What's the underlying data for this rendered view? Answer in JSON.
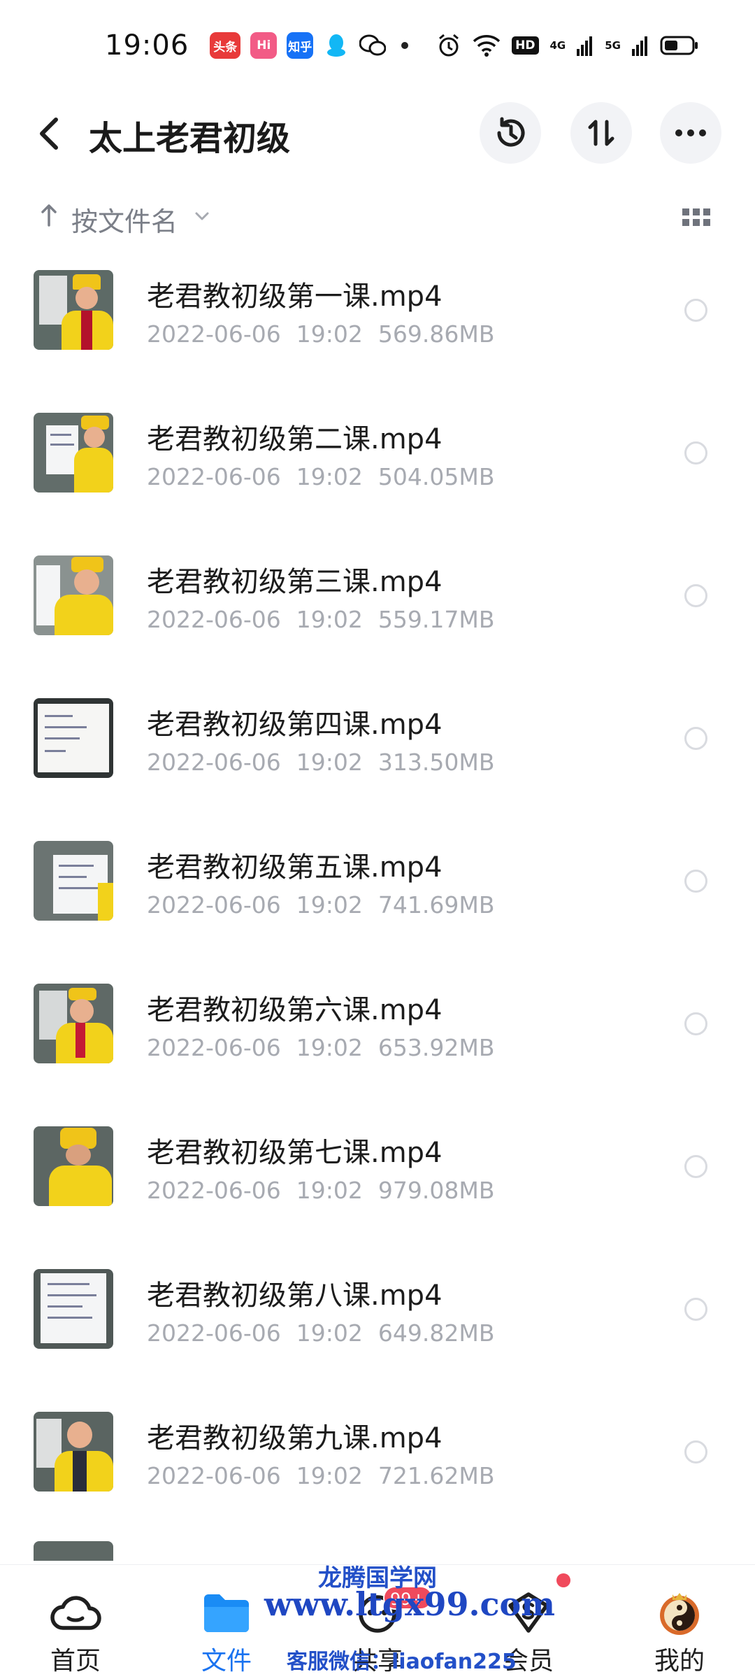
{
  "status_bar": {
    "time": "19:06",
    "notifications": [
      {
        "icon": "toutiao-app-icon",
        "label": "头条"
      },
      {
        "icon": "huohua-app-icon",
        "label": "Hi"
      },
      {
        "icon": "zhihu-app-icon",
        "label": "知乎"
      },
      {
        "icon": "qq-app-icon",
        "label": ""
      },
      {
        "icon": "wechat-app-icon",
        "label": ""
      }
    ],
    "hd_badge": "HD",
    "net1": "4G",
    "net2": "5G"
  },
  "header": {
    "title": "太上老君初级",
    "buttons": [
      "history-button",
      "transfer-button",
      "more-button"
    ]
  },
  "sort": {
    "label": "按文件名"
  },
  "files": [
    {
      "name": "老君教初级第一课.mp4",
      "date": "2022-06-06",
      "time": "19:02",
      "size": "569.86MB"
    },
    {
      "name": "老君教初级第二课.mp4",
      "date": "2022-06-06",
      "time": "19:02",
      "size": "504.05MB"
    },
    {
      "name": "老君教初级第三课.mp4",
      "date": "2022-06-06",
      "time": "19:02",
      "size": "559.17MB"
    },
    {
      "name": "老君教初级第四课.mp4",
      "date": "2022-06-06",
      "time": "19:02",
      "size": "313.50MB"
    },
    {
      "name": "老君教初级第五课.mp4",
      "date": "2022-06-06",
      "time": "19:02",
      "size": "741.69MB"
    },
    {
      "name": "老君教初级第六课.mp4",
      "date": "2022-06-06",
      "time": "19:02",
      "size": "653.92MB"
    },
    {
      "name": "老君教初级第七课.mp4",
      "date": "2022-06-06",
      "time": "19:02",
      "size": "979.08MB"
    },
    {
      "name": "老君教初级第八课.mp4",
      "date": "2022-06-06",
      "time": "19:02",
      "size": "649.82MB"
    },
    {
      "name": "老君教初级第九课.mp4",
      "date": "2022-06-06",
      "time": "19:02",
      "size": "721.62MB"
    }
  ],
  "bottom_nav": [
    {
      "label": "首页",
      "icon": "cloud-icon"
    },
    {
      "label": "文件",
      "icon": "folder-icon",
      "active": true
    },
    {
      "label": "共享",
      "icon": "share-icon",
      "badge": "99+"
    },
    {
      "label": "会员",
      "icon": "vip-icon"
    },
    {
      "label": "我的",
      "icon": "avatar"
    }
  ],
  "watermark": {
    "line1": "龙腾国学网",
    "line2": "www.ltgx99.com",
    "line3": "客服微信：liaofan225"
  },
  "colors": {
    "accent": "#1a73f0",
    "badge": "#f04a5c",
    "meta_text": "#a7aab1"
  }
}
